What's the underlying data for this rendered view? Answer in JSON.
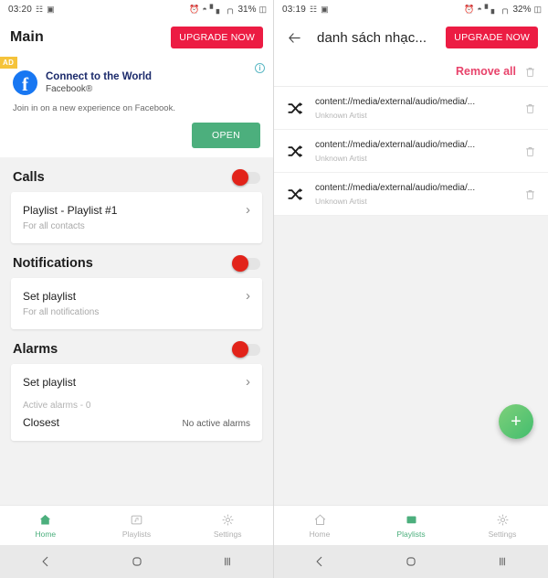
{
  "left": {
    "status": {
      "time": "03:20",
      "left_icons": [
        "vibrate-icon",
        "gallery-icon"
      ],
      "right_icons": [
        "alarm-icon",
        "wifi-icon",
        "signal1-icon",
        "signal2-icon"
      ],
      "battery": "31%"
    },
    "appbar": {
      "title": "Main",
      "upgrade_label": "UPGRADE NOW"
    },
    "ad": {
      "badge": "AD",
      "info": "i",
      "logo_letter": "f",
      "title": "Connect to the World",
      "subtitle": "Facebook®",
      "body": "Join in on a new experience on Facebook.",
      "cta": "OPEN"
    },
    "sections": [
      {
        "title": "Calls",
        "toggle_on": false,
        "item_title": "Playlist - Playlist #1",
        "item_sub": "For all contacts"
      },
      {
        "title": "Notifications",
        "toggle_on": false,
        "item_title": "Set playlist",
        "item_sub": "For all notifications"
      },
      {
        "title": "Alarms",
        "toggle_on": false,
        "item_title": "Set playlist",
        "item_sub": "",
        "active_alarms": "Active alarms - 0",
        "closest_label": "Closest",
        "closest_value": "No active alarms"
      }
    ],
    "nav": [
      {
        "label": "Home",
        "icon": "home-icon",
        "active": true
      },
      {
        "label": "Playlists",
        "icon": "playlists-icon",
        "active": false
      },
      {
        "label": "Settings",
        "icon": "gear-icon",
        "active": false
      }
    ]
  },
  "right": {
    "status": {
      "time": "03:19",
      "battery": "32%"
    },
    "appbar": {
      "back": "back-arrow-icon",
      "title": "danh sách nhạc...",
      "upgrade_label": "UPGRADE NOW"
    },
    "remove_all": {
      "label": "Remove all",
      "icon": "trash-icon"
    },
    "tracks": [
      {
        "title": "content://media/external/audio/media/...",
        "artist": "Unknown Artist"
      },
      {
        "title": "content://media/external/audio/media/...",
        "artist": "Unknown Artist"
      },
      {
        "title": "content://media/external/audio/media/...",
        "artist": "Unknown Artist"
      }
    ],
    "fab": {
      "label": "+",
      "icon": "plus-icon"
    },
    "nav": [
      {
        "label": "Home",
        "icon": "home-icon",
        "active": false
      },
      {
        "label": "Playlists",
        "icon": "playlists-icon",
        "active": true
      },
      {
        "label": "Settings",
        "icon": "gear-icon",
        "active": false
      }
    ]
  },
  "sysnav": {
    "back": "back-triangle-icon",
    "home": "home-circle-icon",
    "recents": "recents-icon"
  },
  "colors": {
    "accent_green": "#4caf7d",
    "upgrade_red": "#ec1c43",
    "toggle_red": "#e2231a",
    "remove_pink": "#e8436b",
    "facebook_blue": "#1877f2",
    "ad_badge": "#f5c33b"
  }
}
